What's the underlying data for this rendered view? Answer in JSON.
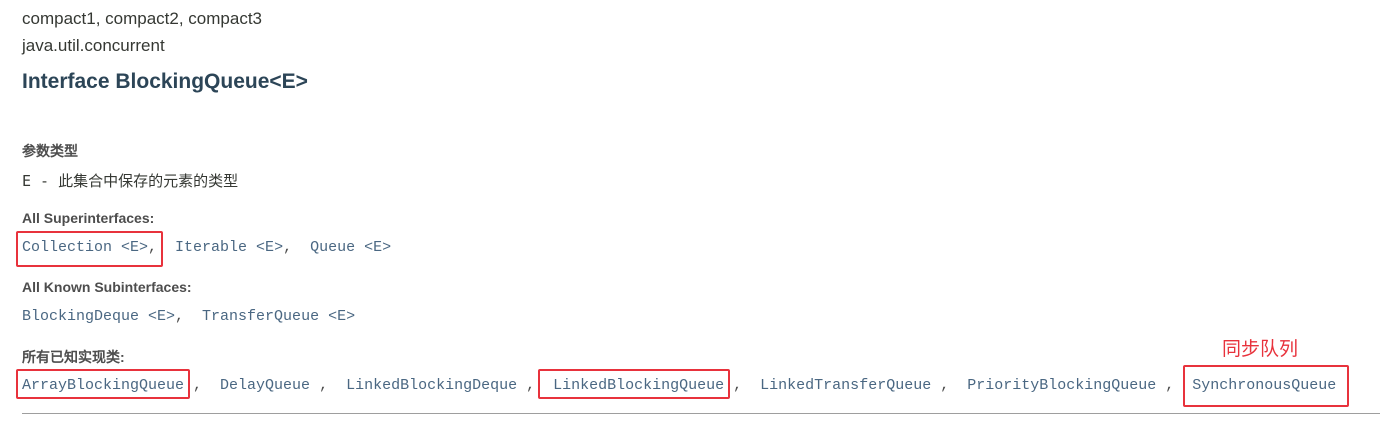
{
  "header": {
    "profiles": "compact1, compact2, compact3",
    "package": "java.util.concurrent",
    "title": "Interface BlockingQueue<E>"
  },
  "type_params": {
    "label": "参数类型",
    "text": "E - 此集合中保存的元素的类型"
  },
  "superinterfaces": {
    "label": "All Superinterfaces:",
    "items": [
      "Collection <E>",
      "Iterable <E>",
      "Queue <E>"
    ]
  },
  "subinterfaces": {
    "label": "All Known Subinterfaces:",
    "items": [
      "BlockingDeque <E>",
      "TransferQueue <E>"
    ]
  },
  "implementing": {
    "label": "所有已知实现类:",
    "items": [
      "ArrayBlockingQueue",
      "DelayQueue",
      "LinkedBlockingDeque",
      "LinkedBlockingQueue",
      "LinkedTransferQueue",
      "PriorityBlockingQueue",
      "SynchronousQueue"
    ]
  },
  "annotation": {
    "text": "同步队列",
    "color": "#e8323c"
  },
  "colors": {
    "link": "#4a6782",
    "title": "#2c4557",
    "highlight": "#e8323c"
  }
}
